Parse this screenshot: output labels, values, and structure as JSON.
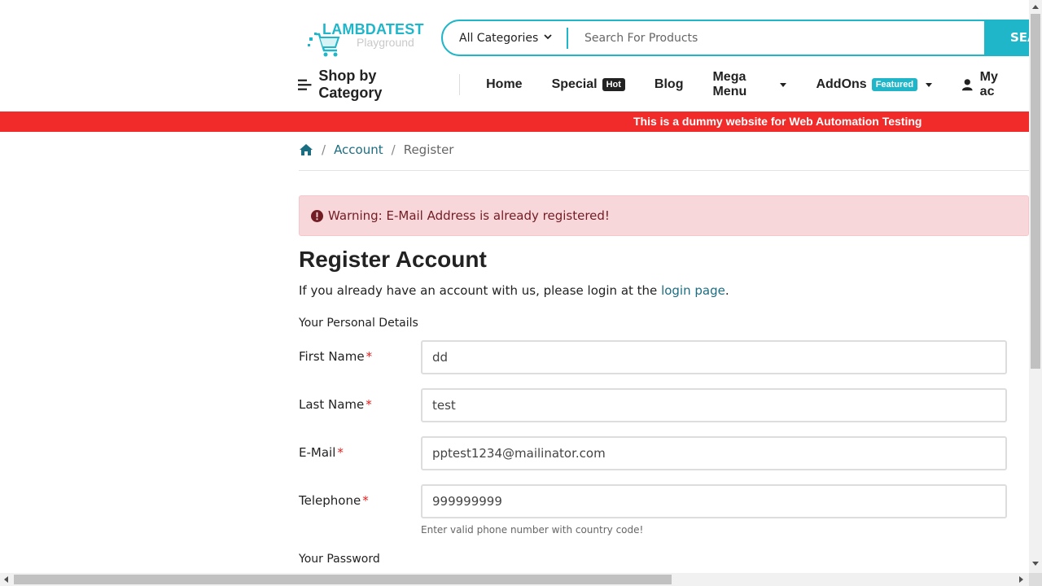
{
  "header": {
    "logo_title": "LAMBDATEST",
    "logo_subtitle": "Playground",
    "category_select": "All Categories",
    "search_placeholder": "Search For Products",
    "search_button": "SEA"
  },
  "nav": {
    "shop_by_category": "Shop by Category",
    "items": [
      {
        "label": "Home"
      },
      {
        "label": "Special",
        "badge": "Hot"
      },
      {
        "label": "Blog"
      },
      {
        "label": "Mega Menu"
      },
      {
        "label": "AddOns",
        "badge": "Featured"
      },
      {
        "label": "My ac"
      }
    ]
  },
  "banner": "This is a dummy website for Web Automation Testing",
  "breadcrumb": {
    "account": "Account",
    "register": "Register"
  },
  "alert": "Warning: E-Mail Address is already registered!",
  "page": {
    "title": "Register Account",
    "intro_prefix": "If you already have an account with us, please login at the ",
    "login_link": "login page",
    "intro_suffix": "."
  },
  "form": {
    "personal_legend": "Your Personal Details",
    "fields": [
      {
        "label": "First Name",
        "value": "dd"
      },
      {
        "label": "Last Name",
        "value": "test"
      },
      {
        "label": "E-Mail",
        "value": "pptest1234@mailinator.com"
      },
      {
        "label": "Telephone",
        "value": "999999999"
      }
    ],
    "required_mark": "*",
    "telephone_help": "Enter valid phone number with country code!",
    "password_legend": "Your Password"
  },
  "colors": {
    "accent": "#1fb6c9",
    "banner": "#f12a2a",
    "alert_bg": "#f8d7da",
    "alert_text": "#721c24",
    "link": "#1b6d82"
  }
}
